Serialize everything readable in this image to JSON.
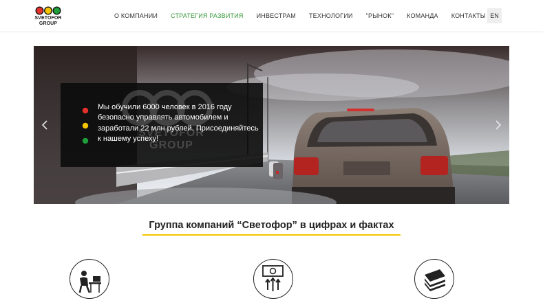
{
  "header": {
    "logo_text": "SVETOFOR\nGROUP",
    "nav": [
      {
        "label": "О компании",
        "active": false
      },
      {
        "label": "Стратегия развития",
        "active": true
      },
      {
        "label": "Инвестрам",
        "active": false
      },
      {
        "label": "Технологии",
        "active": false
      },
      {
        "label": "\"Рынок\"",
        "active": false
      },
      {
        "label": "Команда",
        "active": false
      },
      {
        "label": "Контакты",
        "active": false
      }
    ],
    "lang": "EN"
  },
  "hero": {
    "text": "Мы обучили 6000 человек в 2016 году безопасно управлять автомобилем и заработали 22 млн рублей. Присоединяйтесь к нашему успеху!",
    "watermark": "SVETOFOR GROUP",
    "icons": {
      "prev": "chevron-left-icon",
      "next": "chevron-right-icon"
    }
  },
  "section": {
    "title": "Группа компаний “Светофор” в цифрах и фактах",
    "icons": [
      "person-at-desk-icon",
      "money-growth-icon",
      "money-stack-icon"
    ]
  },
  "colors": {
    "accent_green": "#3b9a3d",
    "underline_yellow": "#f2c500",
    "light_red": "#e4312b",
    "light_yellow": "#f5c400",
    "light_green": "#1e9e3a"
  }
}
